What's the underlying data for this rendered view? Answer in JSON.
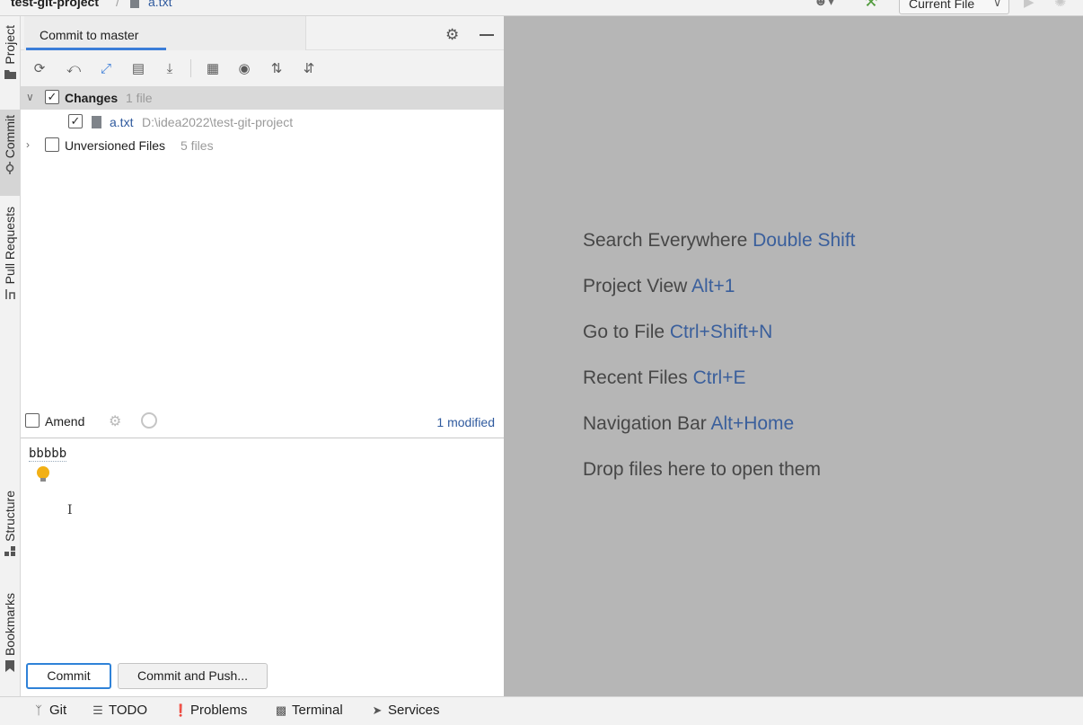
{
  "navbar": {
    "project": "test-git-project",
    "separator": "/",
    "file": "a.txt",
    "run_config": "Current File"
  },
  "left_strip": {
    "tabs": [
      {
        "label": "Project",
        "icon": "folder-icon"
      },
      {
        "label": "Commit",
        "icon": "commit-icon"
      },
      {
        "label": "Pull Requests",
        "icon": "pull-request-icon"
      },
      {
        "label": "Structure",
        "icon": "structure-icon"
      },
      {
        "label": "Bookmarks",
        "icon": "bookmark-icon"
      }
    ]
  },
  "commit_panel": {
    "tab_title": "Commit to master",
    "toolbar_icons": [
      "refresh-icon",
      "rollback-icon",
      "diff-icon",
      "shelve-icon",
      "update-icon",
      "group-by-icon",
      "view-options-icon",
      "expand-all-icon",
      "collapse-all-icon"
    ],
    "tree": {
      "changes": {
        "label": "Changes",
        "count": "1 file"
      },
      "file": {
        "name": "a.txt",
        "path": "D:\\idea2022\\test-git-project"
      },
      "unversioned": {
        "label": "Unversioned Files",
        "count": "5 files"
      }
    },
    "amend_label": "Amend",
    "modified_text": "1 modified",
    "message": "bbbbb",
    "commit_button": "Commit",
    "commit_push_button": "Commit and Push..."
  },
  "editor_hints": [
    {
      "text": "Search Everywhere",
      "key": "Double Shift"
    },
    {
      "text": "Project View",
      "key": "Alt+1"
    },
    {
      "text": "Go to File",
      "key": "Ctrl+Shift+N"
    },
    {
      "text": "Recent Files",
      "key": "Ctrl+E"
    },
    {
      "text": "Navigation Bar",
      "key": "Alt+Home"
    },
    {
      "text": "Drop files here to open them",
      "key": ""
    }
  ],
  "bottom_tools": [
    {
      "label": "Git",
      "icon": "git-branch-icon"
    },
    {
      "label": "TODO",
      "icon": "todo-icon"
    },
    {
      "label": "Problems",
      "icon": "problems-icon"
    },
    {
      "label": "Terminal",
      "icon": "terminal-icon"
    },
    {
      "label": "Services",
      "icon": "services-icon"
    }
  ],
  "colors": {
    "accent": "#3b7dd8",
    "link": "#2f5a9e",
    "editor_bg": "#b6b6b6"
  }
}
